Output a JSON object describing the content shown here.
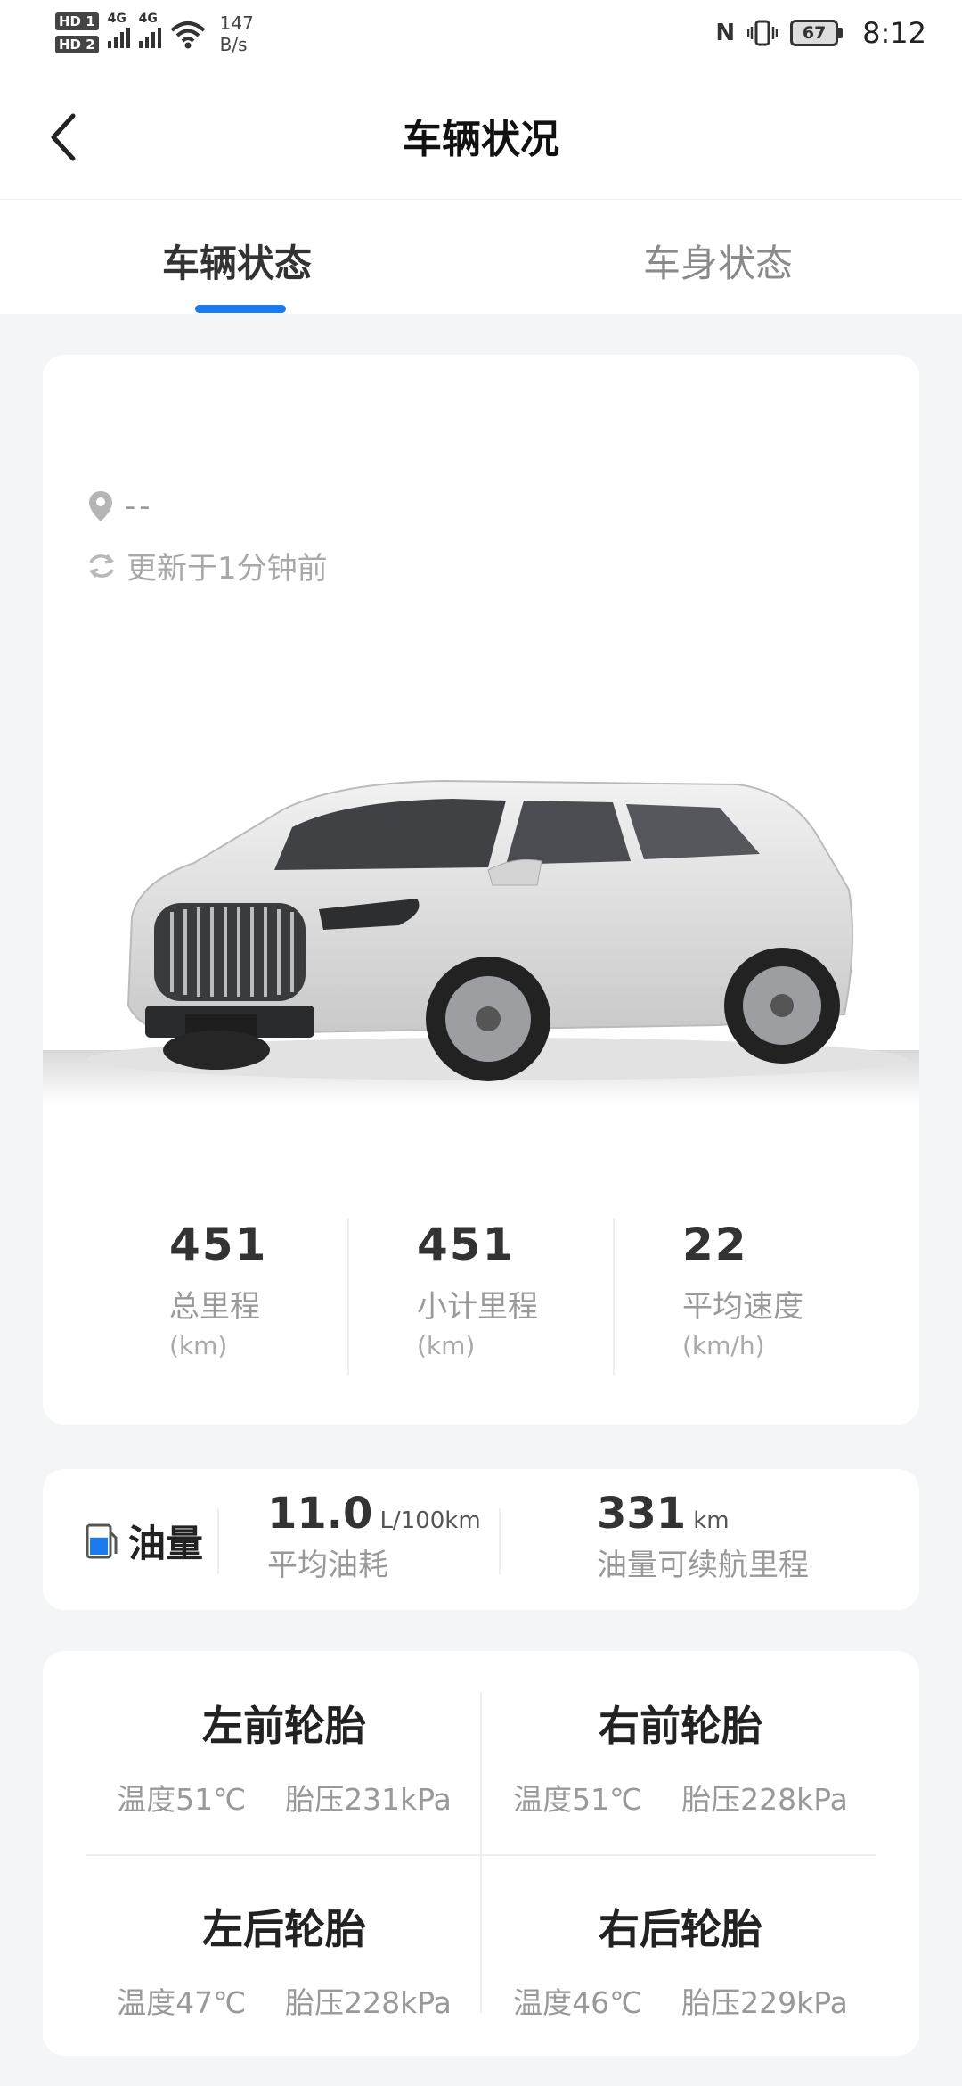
{
  "status_bar": {
    "hd1": "HD 1",
    "hd2": "HD 2",
    "net1": "4G",
    "net2": "4G",
    "speed_value": "147",
    "speed_unit": "B/s",
    "nfc": "N",
    "battery": "67",
    "time": "8:12"
  },
  "header": {
    "title": "车辆状况"
  },
  "tabs": [
    {
      "label": "车辆状态",
      "active": true
    },
    {
      "label": "车身状态",
      "active": false
    }
  ],
  "vehicle": {
    "location": "--",
    "updated": "更新于1分钟前",
    "stats": [
      {
        "value": "451",
        "label": "总里程",
        "unit": "(km)"
      },
      {
        "value": "451",
        "label": "小计里程",
        "unit": "(km)"
      },
      {
        "value": "22",
        "label": "平均速度",
        "unit": "(km/h)"
      }
    ]
  },
  "fuel": {
    "label": "油量",
    "avg_value": "11.0",
    "avg_unit": "L/100km",
    "avg_label": "平均油耗",
    "range_value": "331",
    "range_unit": "km",
    "range_label": "油量可续航里程",
    "level_fraction": 0.6
  },
  "tires": [
    {
      "name": "左前轮胎",
      "temp": "温度51℃",
      "pressure": "胎压231kPa"
    },
    {
      "name": "右前轮胎",
      "temp": "温度51℃",
      "pressure": "胎压228kPa"
    },
    {
      "name": "左后轮胎",
      "temp": "温度47℃",
      "pressure": "胎压228kPa"
    },
    {
      "name": "右后轮胎",
      "temp": "温度46℃",
      "pressure": "胎压229kPa"
    }
  ],
  "colors": {
    "accent": "#1a7cf0",
    "background": "#f4f5f7",
    "card": "#ffffff"
  }
}
